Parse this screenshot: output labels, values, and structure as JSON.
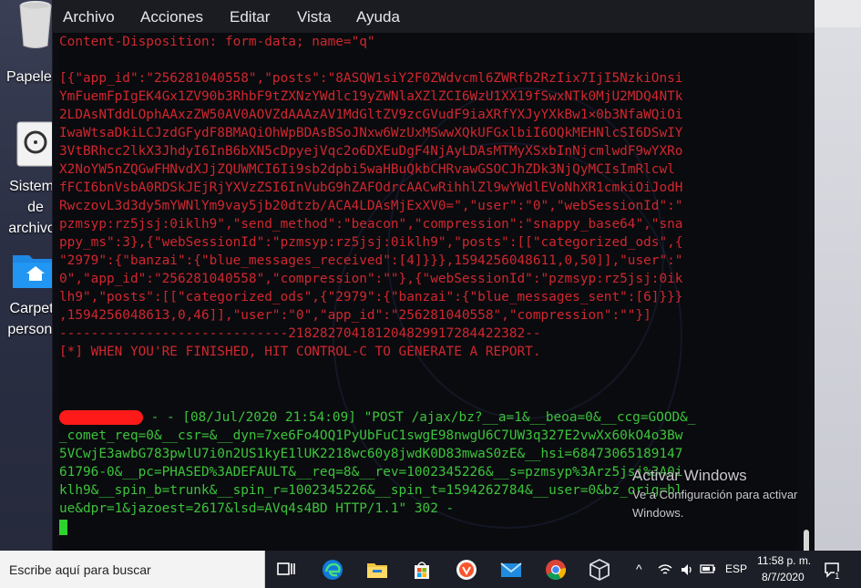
{
  "desktop": {
    "icons": [
      {
        "label": "Papelera"
      },
      {
        "label_lines": [
          "Sistema de",
          "archivos"
        ]
      },
      {
        "label_lines": [
          "Carpeta",
          "personal"
        ]
      }
    ]
  },
  "terminal": {
    "menu": [
      "Archivo",
      "Acciones",
      "Editar",
      "Vista",
      "Ayuda"
    ],
    "lines_red": [
      "Content-Disposition: form-data; name=\"q\"",
      "",
      "[{\"app_id\":\"256281040558\",\"posts\":\"8ASQW1siY2F0ZWdvcml6ZWRfb2RzIix7IjI5NzkiOnsi",
      "YmFuemFpIgEK4Gx1ZV90b3RhbF9tZXNzYWdlc19yZWNlaXZlZCI6WzU1XX19fSwxNTk0MjU2MDQ4NTk",
      "2LDAsNTddLOphAAxzZW50AV0AOVZdAAAzAV1MdGltZV9zcGVudF9iaXRfYXJyYXkBw1×0b3NfaWQiOi",
      "IwaWtsaDkiLCJzdGFydF8BMAQiOhWpBDAsBSoJNxw6WzUxMSwwXQkUFGxlbiI6OQkMEHNlcSI6DSwIY",
      "3VtBRhcc2lkX3JhdyI6InB6bXN5cDpyejVqc2o6DXEuDgF4NjAyLDAsMTMyXSxbInNjcmlwdF9wYXRo",
      "X2NoYW5nZQGwFHNvdXJjZQUWMCI6Ii9sb2dpbi5waHBuQkbCHRvawGSOCJhZDk3NjQyMCIsImRlcwl",
      "fFCI6bnVsbA0RDSkJEjRjYXVzZSI6InVubG9hZAFOdrcAACwRihhlZl9wYWdlEVoNhXR1cmkiOiJodH",
      "RwczovL3d3dy5mYWNlYm9vay5jb20dtzb/ACA4LDAsMjExXV0=\",\"user\":\"0\",\"webSessionId\":\"",
      "pzmsyp:rz5jsj:0iklh9\",\"send_method\":\"beacon\",\"compression\":\"snappy_base64\",\"sna",
      "ppy_ms\":3},{\"webSessionId\":\"pzmsyp:rz5jsj:0iklh9\",\"posts\":[[\"categorized_ods\",{",
      "\"2979\":{\"banzai\":{\"blue_messages_received\":[4]}}},1594256048611,0,50]],\"user\":\"",
      "0\",\"app_id\":\"256281040558\",\"compression\":\"\"},{\"webSessionId\":\"pzmsyp:rz5jsj:0ik",
      "lh9\",\"posts\":[[\"categorized_ods\",{\"2979\":{\"banzai\":{\"blue_messages_sent\":[6]}}}",
      ",1594256048613,0,46]],\"user\":\"0\",\"app_id\":\"256281040558\",\"compression\":\"\"}]",
      "-----------------------------218282704181204829917284422382--",
      "[*] WHEN YOU'RE FINISHED, HIT CONTROL-C TO GENERATE A REPORT."
    ],
    "request_first": " - - [08/Jul/2020 21:54:09] \"POST /ajax/bz?__a=1&__beoa=0&__ccg=GOOD&_",
    "lines_green": [
      "_comet_req=0&__csr=&__dyn=7xe6Fo4OQ1PyUbFuC1swgE98nwgU6C7UW3q327E2vwXx60kO4o3Bw",
      "5VCwjE3awbG783pwlU7i0n2US1kyE1lUK2218wc60y8jwdK0D83mwaS0zE&__hsi=68473065189147",
      "61796-0&__pc=PHASED%3ADEFAULT&__req=8&__rev=1002345226&__s=pzmsyp%3Arz5jsj%3A0i",
      "klh9&__spin_b=trunk&__spin_r=1002345226&__spin_t=1594262784&__user=0&bz_orig=bl",
      "ue&dpr=1&jazoest=2617&lsd=AVq4s4BD HTTP/1.1\" 302 -"
    ]
  },
  "watermark": {
    "title": "Activar Windows",
    "line1": "Ve a Configuración para activar",
    "line2": "Windows."
  },
  "taskbar": {
    "search_placeholder": "Escribe aquí para buscar",
    "language": "ESP",
    "time": "11:58 p. m.",
    "date": "8/7/2020",
    "notification_count": "1"
  }
}
